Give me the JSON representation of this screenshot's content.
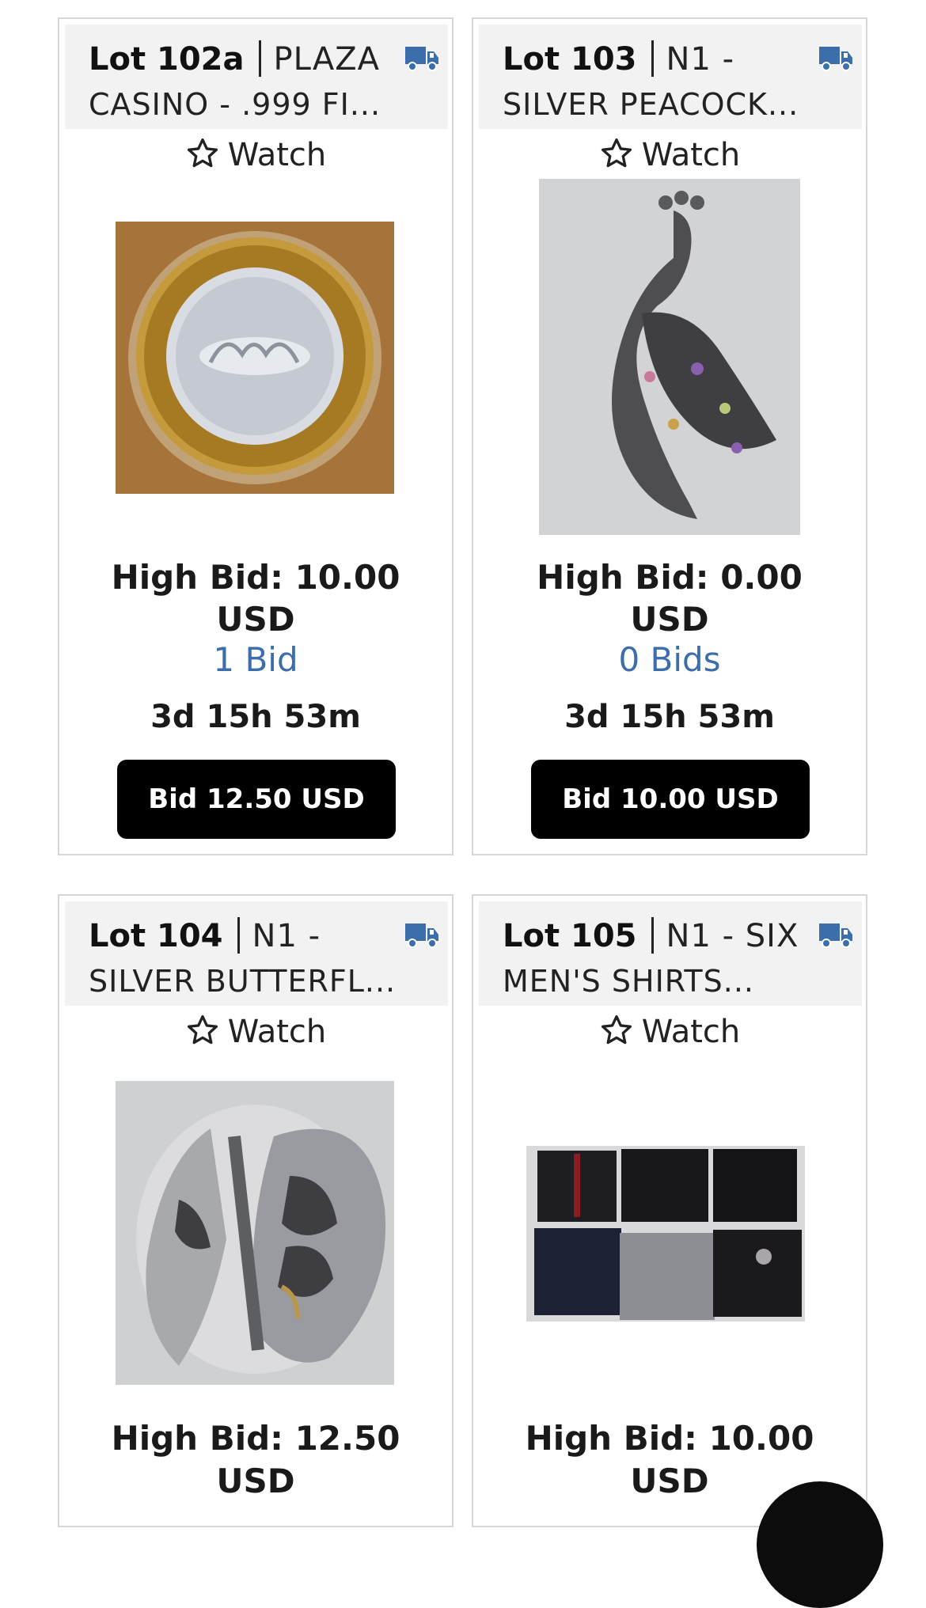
{
  "lots": [
    {
      "lot_number": "Lot 102a",
      "title_line1": "PLAZA",
      "title_line2": "CASINO - .999 FI...",
      "watch_label": "Watch",
      "high_bid_line1": "High Bid: 10.00",
      "high_bid_line2": "USD",
      "bid_count": "1 Bid",
      "time_left": "3d 15h 53m",
      "bid_button": "Bid 12.50 USD"
    },
    {
      "lot_number": "Lot 103",
      "title_line1": "N1 -",
      "title_line2": "SILVER PEACOCK...",
      "watch_label": "Watch",
      "high_bid_line1": "High Bid: 0.00",
      "high_bid_line2": "USD",
      "bid_count": "0 Bids",
      "time_left": "3d 15h 53m",
      "bid_button": "Bid 10.00 USD"
    },
    {
      "lot_number": "Lot 104",
      "title_line1": "N1 -",
      "title_line2": "SILVER BUTTERFL...",
      "watch_label": "Watch",
      "high_bid_line1": "High Bid: 12.50",
      "high_bid_line2": "USD"
    },
    {
      "lot_number": "Lot 105",
      "title_line1": "N1 - SIX",
      "title_line2": "MEN'S SHIRTS...",
      "watch_label": "Watch",
      "high_bid_line1": "High Bid: 10.00",
      "high_bid_line2": "USD"
    }
  ],
  "icons": {
    "shipping": "truck-icon",
    "watch": "star-outline-icon"
  },
  "colors": {
    "accent_blue": "#3b6eaa",
    "button_bg": "#000000",
    "header_bg": "#f2f2f2"
  }
}
